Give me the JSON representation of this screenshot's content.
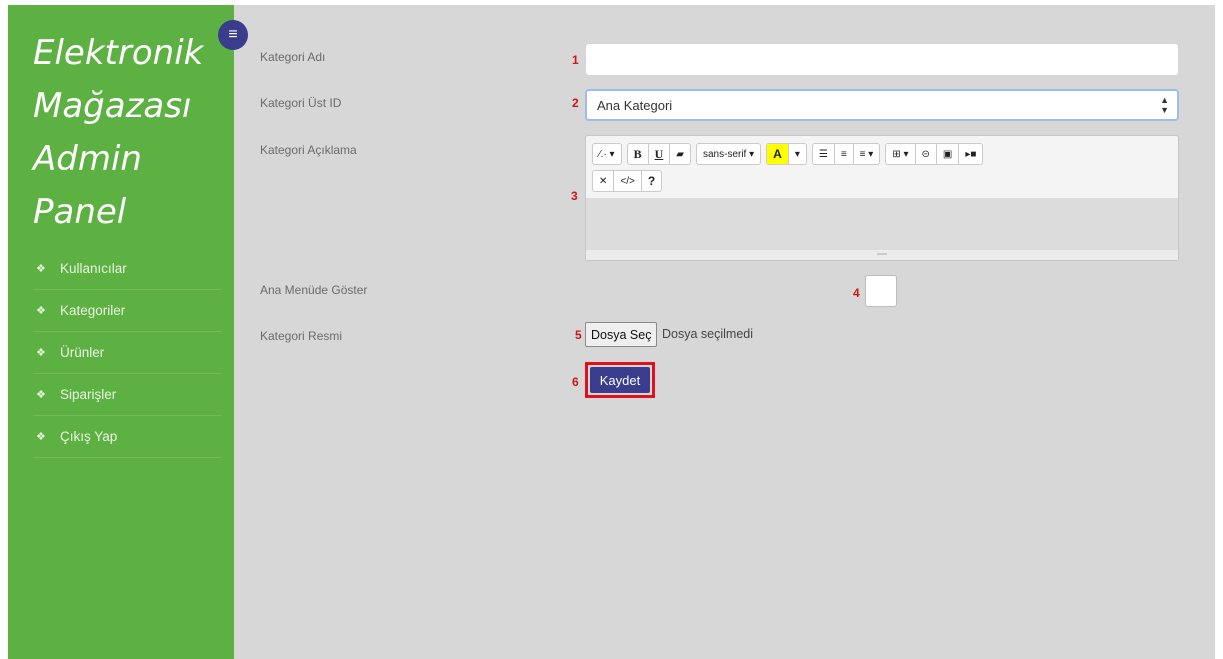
{
  "brand": [
    "Elektronik",
    "Mağazası",
    "Admin",
    "Panel"
  ],
  "colors": {
    "sidebar": "#5db142",
    "accent": "#3a3d8c",
    "annotation": "#d11414"
  },
  "icons": {
    "toggle": "menu-icon",
    "menu_item": "home-icon"
  },
  "menu": [
    "Kullanıcılar",
    "Kategoriler",
    "Ürünler",
    "Siparişler",
    "Çıkış Yap"
  ],
  "form": {
    "category_name_label": "Kategori Adı",
    "category_name_value": "",
    "parent_id_label": "Kategori Üst ID",
    "parent_id_value": "Ana Kategori",
    "description_label": "Kategori Açıklama",
    "show_in_menu_label": "Ana Menüde Göster",
    "image_label": "Kategori Resmi",
    "file_button": "Dosya Seç",
    "file_status": "Dosya seçilmedi",
    "save_button": "Kaydet"
  },
  "toolbar": {
    "magic": "⁄.·",
    "bold": "B",
    "underline": "U",
    "eraser": "▰",
    "font": "sans-serif",
    "color": "A",
    "table": "⊞",
    "link": "⊝",
    "picture": "▣",
    "video": "▸■",
    "fullscreen": "✕",
    "code": "</>",
    "help": "?"
  },
  "annotations": [
    "1",
    "2",
    "3",
    "4",
    "5",
    "6"
  ]
}
